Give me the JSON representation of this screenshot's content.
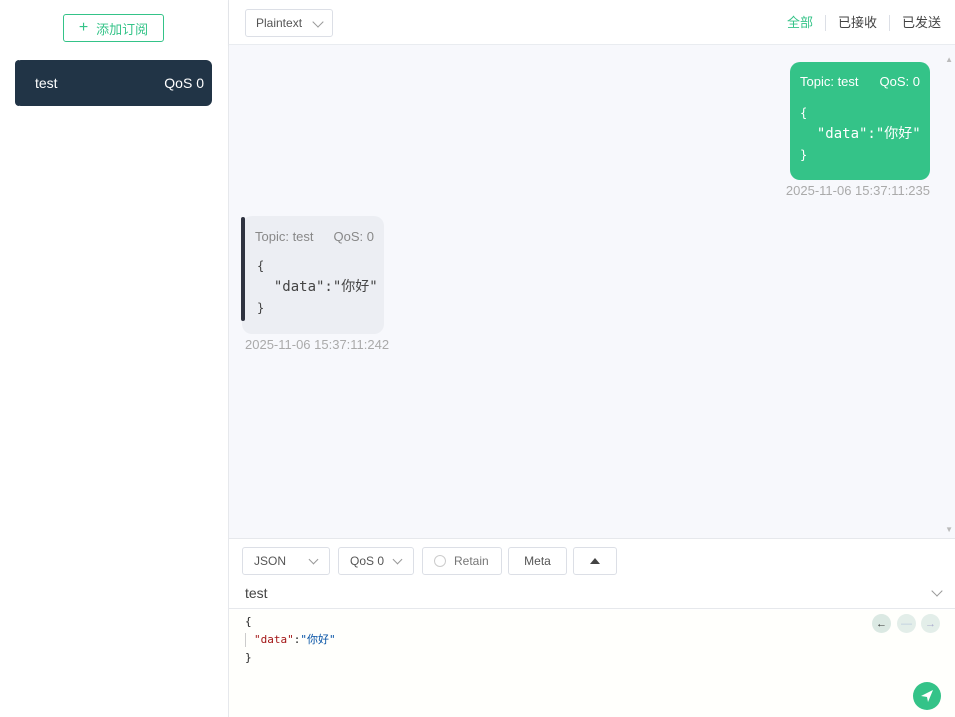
{
  "sidebar": {
    "add_subscription_label": "添加订阅",
    "subscriptions": [
      {
        "topic": "test",
        "qos": "QoS 0",
        "color": "#213446"
      }
    ]
  },
  "topbar": {
    "format": "Plaintext",
    "filters": [
      "全部",
      "已接收",
      "已发送"
    ],
    "active_filter": "全部"
  },
  "messages": [
    {
      "direction": "outgoing",
      "topic": "Topic: test",
      "qos": "QoS: 0",
      "body_open": "{",
      "body_line": "  \"data\":\"你好\"",
      "body_close": "}",
      "time": "2025-11-06 15:37:11:235"
    },
    {
      "direction": "incoming",
      "topic": "Topic: test",
      "qos": "QoS: 0",
      "body_open": "{",
      "body_line": "  \"data\":\"你好\"",
      "body_close": "}",
      "time": "2025-11-06 15:37:11:242"
    }
  ],
  "composer": {
    "payload_format": "JSON",
    "qos": "QoS 0",
    "retain_label": "Retain",
    "meta_label": "Meta",
    "topic": "test",
    "payload": {
      "open": "{",
      "key": "\"data\"",
      "colon": ":",
      "value": "\"你好\"",
      "close": "}"
    }
  },
  "colors": {
    "accent": "#34c388",
    "sidebar_item_bg": "#213446",
    "incoming_bubble": "#eceef3"
  }
}
